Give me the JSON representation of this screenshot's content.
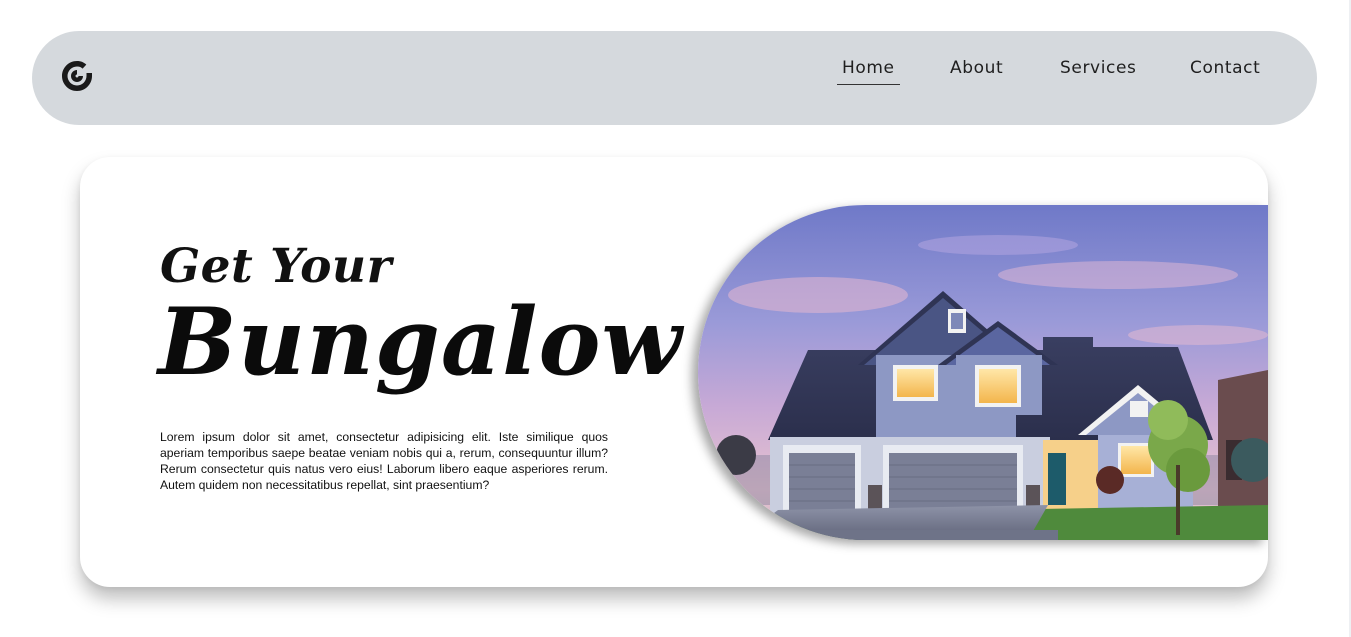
{
  "nav": {
    "logo_icon": "spiral-logo-icon",
    "links": [
      {
        "label": "Home",
        "active": true
      },
      {
        "label": "About",
        "active": false
      },
      {
        "label": "Services",
        "active": false
      },
      {
        "label": "Contact",
        "active": false
      }
    ]
  },
  "hero": {
    "subtitle": "Get Your",
    "title": "Bungalow",
    "description": "Lorem ipsum dolor sit amet, consectetur adipisicing elit. Iste similique quos aperiam temporibus saepe beatae veniam nobis qui a, rerum, consequuntur illum? Rerum consectetur quis natus vero eius! Laborum libero eaque asperiores rerum. Autem quidem non necessitatibus repellat, sint praesentium?",
    "image_icon": "house-photo"
  },
  "colors": {
    "navbar_bg": "#d5d9dd",
    "card_bg": "#ffffff",
    "text": "#111111"
  }
}
